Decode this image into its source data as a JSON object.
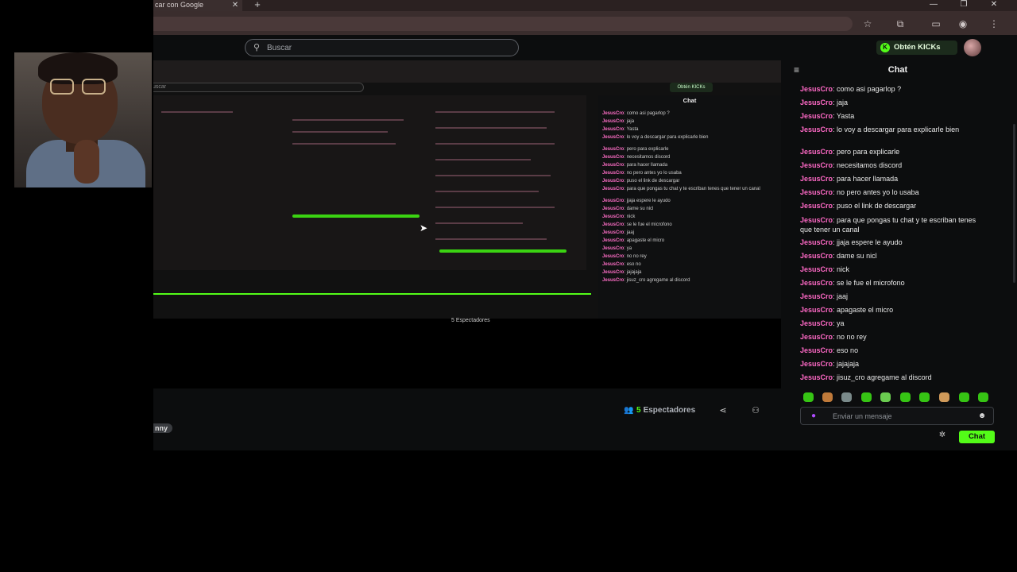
{
  "browser": {
    "tab_title": "car con Google",
    "tab_close": "✕",
    "new_tab": "+",
    "window_controls": [
      "—",
      "❐",
      "✕"
    ]
  },
  "kick": {
    "search_placeholder": "Buscar",
    "kicks_button": "Obtén KICKs",
    "streamer_tag": "nny",
    "viewers_count": "5",
    "viewers_label": "Espectadores",
    "chat": {
      "title": "Chat",
      "messages": [
        {
          "user": "JesusCro",
          "text": "como asi pagarlop ?"
        },
        {
          "user": "JesusCro",
          "text": "jaja"
        },
        {
          "user": "JesusCro",
          "text": "Yasta"
        },
        {
          "user": "JesusCro",
          "text": "lo voy a descargar para explicarle bien"
        },
        {
          "user": "JesusCro",
          "text": "pero para explicarle"
        },
        {
          "user": "JesusCro",
          "text": "necesitamos discord"
        },
        {
          "user": "JesusCro",
          "text": "para hacer llamada"
        },
        {
          "user": "JesusCro",
          "text": "no pero antes yo lo usaba"
        },
        {
          "user": "JesusCro",
          "text": "puso el link de descargar"
        },
        {
          "user": "JesusCro",
          "text": "para que pongas tu chat y te escriban tenes que tener un canal"
        },
        {
          "user": "JesusCro",
          "text": "jjaja espere le ayudo"
        },
        {
          "user": "JesusCro",
          "text": "dame su nicl"
        },
        {
          "user": "JesusCro",
          "text": "nick"
        },
        {
          "user": "JesusCro",
          "text": "se le fue el microfono"
        },
        {
          "user": "JesusCro",
          "text": "jaaj"
        },
        {
          "user": "JesusCro",
          "text": "apagaste el micro"
        },
        {
          "user": "JesusCro",
          "text": "ya"
        },
        {
          "user": "JesusCro",
          "text": "no no rey"
        },
        {
          "user": "JesusCro",
          "text": "eso no"
        },
        {
          "user": "JesusCro",
          "text": "jajajaja"
        },
        {
          "user": "JesusCro",
          "text": "jisuz_cro agregame al discord"
        }
      ],
      "input_placeholder": "Enviar un mensaje",
      "send_label": "Chat"
    },
    "nested": {
      "search_placeholder": "uscar",
      "kicks_button": "Obtén KICKs",
      "chat_title": "Chat",
      "viewers": "5 Espectadores"
    }
  },
  "colors": {
    "kick_green": "#53fc18",
    "username_pink": "#ff69c6",
    "page_bg": "#0c0d0e",
    "browser_chrome": "#3a2d2d"
  },
  "icons": [
    "search-icon",
    "star-icon",
    "extensions-icon",
    "sidebar-icon",
    "profile-icon",
    "menu-icon",
    "chat-collapse-icon",
    "viewers-icon",
    "share-icon",
    "follow-icon",
    "mic-icon",
    "emoji-icon",
    "settings-icon"
  ]
}
